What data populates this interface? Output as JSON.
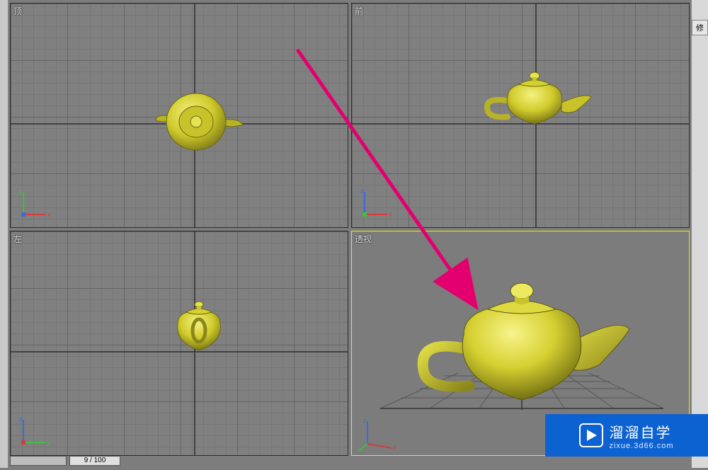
{
  "viewports": {
    "top_left": {
      "label": "顶",
      "axes": [
        "x",
        "y"
      ],
      "active": false
    },
    "top_right": {
      "label": "前",
      "axes": [
        "x",
        "z"
      ],
      "active": false
    },
    "bottom_left": {
      "label": "左",
      "axes": [
        "y",
        "z"
      ],
      "active": false
    },
    "bottom_right": {
      "label": "透视",
      "axes": [
        "x",
        "z"
      ],
      "active": true
    }
  },
  "timeline": {
    "frame_display": "9 / 100"
  },
  "right_panel": {
    "tab_label": "修"
  },
  "watermark": {
    "title": "溜溜自学",
    "url": "zixue.3d66.com"
  },
  "colors": {
    "teapot": "#d8d22e",
    "grid_minor": "#6d6d6d",
    "grid_major": "#474747",
    "axis_x": "#d63c3c",
    "axis_y": "#3cc23c",
    "axis_z": "#3c6cd6",
    "highlight": "#f5e600",
    "arrow": "#e3006e"
  }
}
